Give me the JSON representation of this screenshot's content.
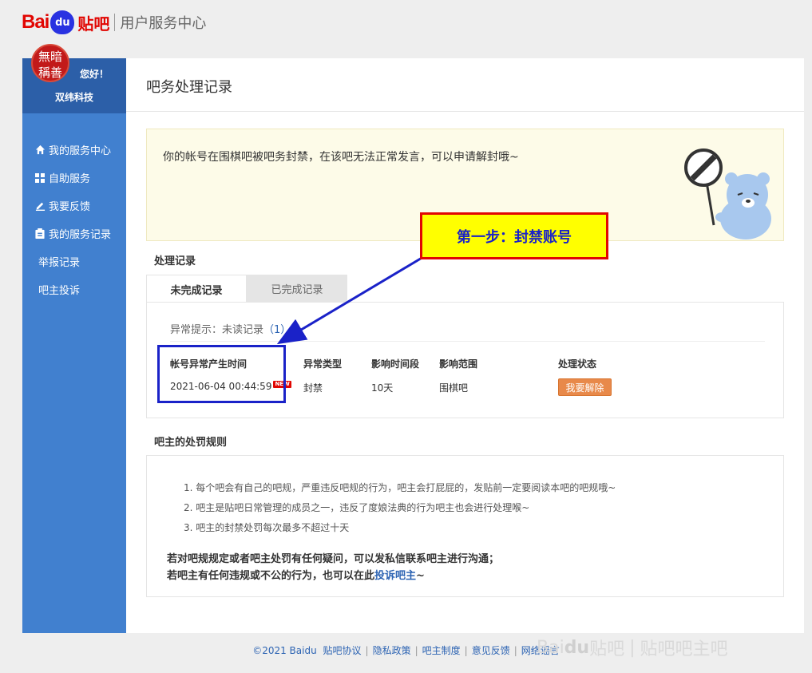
{
  "header": {
    "logo_bai": "Bai",
    "logo_du": "du",
    "logo_tieba": "贴吧",
    "center_title": "用户服务中心"
  },
  "sidebar": {
    "avatar_text": "無暗\n稱善",
    "greeting": "您好！",
    "username": "双纬科技",
    "items": [
      {
        "label": "我的服务中心",
        "icon": "home-icon"
      },
      {
        "label": "自助服务",
        "icon": "grid-icon"
      },
      {
        "label": "我要反馈",
        "icon": "pencil-icon"
      },
      {
        "label": "我的服务记录",
        "icon": "clipboard-icon"
      },
      {
        "label": "举报记录"
      },
      {
        "label": "吧主投诉"
      }
    ]
  },
  "main": {
    "title": "吧务处理记录",
    "notice": "你的帐号在围棋吧被吧务封禁，在该吧无法正常发言，可以申请解封哦~",
    "records_label": "处理记录",
    "tabs": [
      {
        "label": "未完成记录",
        "active": true
      },
      {
        "label": "已完成记录",
        "active": false
      }
    ],
    "abnormal_prefix": "异常提示：未读记录",
    "abnormal_count": "（1）",
    "table": {
      "headers": [
        "帐号异常产生时间",
        "异常类型",
        "影响时间段",
        "影响范围",
        "处理状态"
      ],
      "row": {
        "time": "2021-06-04 00:44:59",
        "badge": "NEW",
        "type": "封禁",
        "duration": "10天",
        "scope": "围棋吧",
        "action": "我要解除"
      }
    },
    "rules_label": "吧主的处罚规则",
    "rules": [
      "1. 每个吧会有自己的吧规，严重违反吧规的行为，吧主会打屁屁的，发贴前一定要阅读本吧的吧规哦~",
      "2. 吧主是贴吧日常管理的成员之一，违反了度娘法典的行为吧主也会进行处理喉~",
      "3. 吧主的封禁处罚每次最多不超过十天"
    ],
    "rules_note1": "若对吧规规定或者吧主处罚有任何疑问，可以发私信联系吧主进行沟通；",
    "rules_note2_prefix": "若吧主有任何违规或不公的行为，也可以在此",
    "rules_note2_link": "投诉吧主",
    "rules_note2_suffix": "~"
  },
  "annotation": {
    "callout": "第一步：封禁账号",
    "colors": {
      "callout_bg": "#ffff00",
      "callout_border": "#e10602",
      "callout_text": "#1a22c8",
      "arrow": "#1a22c8"
    }
  },
  "footer": {
    "copyright": "©2021 Baidu",
    "links": [
      "贴吧协议",
      "隐私政策",
      "吧主制度",
      "意见反馈",
      "网络谣言"
    ]
  },
  "watermark": {
    "bai": "Bai",
    "du": "du",
    "tieba": "贴吧",
    "sub": "贴吧吧主吧"
  }
}
